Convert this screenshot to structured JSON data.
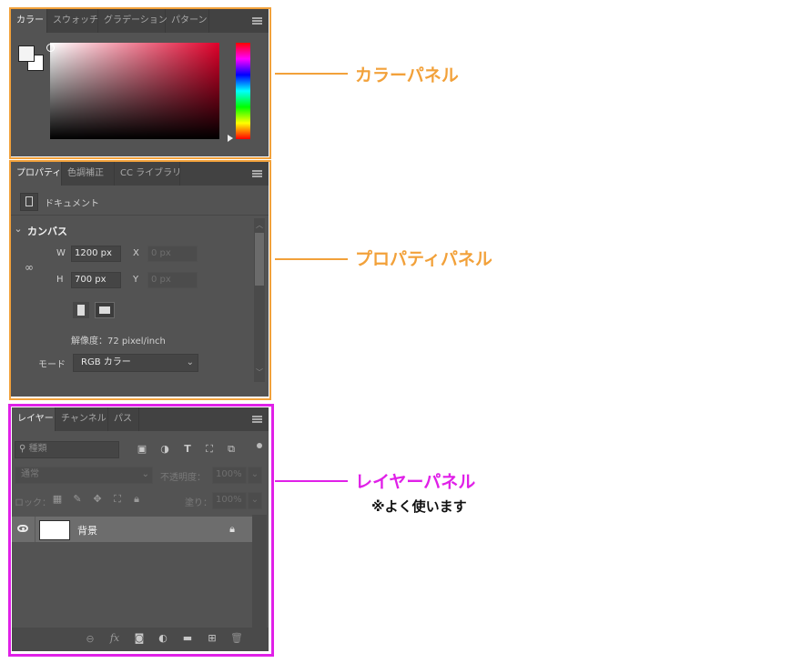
{
  "colors": {
    "orange": "#f2a13a",
    "magenta": "#e020e8",
    "panel_bg": "#535353",
    "tabbar_bg": "#424242"
  },
  "color_panel": {
    "tabs": [
      "カラー",
      "スウォッチ",
      "グラデーション",
      "パターン"
    ],
    "menu_icon": "panel-menu-icon"
  },
  "properties_panel": {
    "tabs": [
      "プロパティ",
      "色調補正",
      "CC ライブラリ"
    ],
    "document_label": "ドキュメント",
    "section_title": "カンバス",
    "w_label": "W",
    "w_value": "1200 px",
    "h_label": "H",
    "h_value": "700 px",
    "x_label": "X",
    "x_value": "0 px",
    "y_label": "Y",
    "y_value": "0 px",
    "resolution": "解像度：72 pixel/inch",
    "mode_label": "モード",
    "mode_value": "RGB カラー"
  },
  "layers_panel": {
    "tabs": [
      "レイヤー",
      "チャンネル",
      "パス"
    ],
    "filter_placeholder": "種類",
    "blend_mode": "通常",
    "opacity_label": "不透明度：",
    "opacity_value": "100%",
    "lock_label": "ロック：",
    "fill_label": "塗り：",
    "fill_value": "100%",
    "layer_name": "背景"
  },
  "callouts": {
    "color": "カラーパネル",
    "properties": "プロパティパネル",
    "layers": "レイヤーパネル",
    "layers_note": "※よく使います"
  }
}
